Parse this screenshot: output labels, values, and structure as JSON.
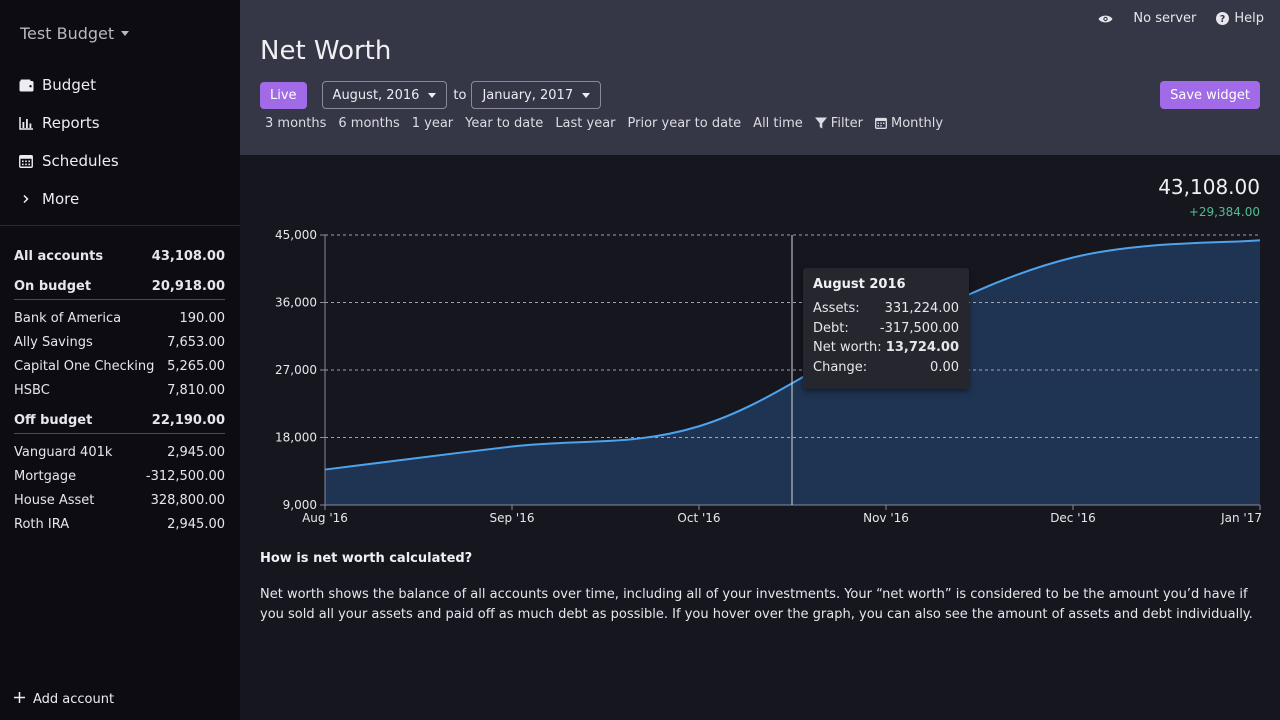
{
  "sidebar": {
    "budget_name": "Test Budget",
    "nav": [
      {
        "label": "Budget",
        "icon": "wallet-icon"
      },
      {
        "label": "Reports",
        "icon": "bar-chart-icon"
      },
      {
        "label": "Schedules",
        "icon": "calendar-icon"
      },
      {
        "label": "More",
        "icon": "chevron-right-icon"
      }
    ],
    "all_accounts": {
      "label": "All accounts",
      "value": "43,108.00"
    },
    "on_budget": {
      "label": "On budget",
      "value": "20,918.00"
    },
    "on_budget_accounts": [
      {
        "name": "Bank of America",
        "value": "190.00"
      },
      {
        "name": "Ally Savings",
        "value": "7,653.00"
      },
      {
        "name": "Capital One Checking",
        "value": "5,265.00"
      },
      {
        "name": "HSBC",
        "value": "7,810.00"
      }
    ],
    "off_budget": {
      "label": "Off budget",
      "value": "22,190.00"
    },
    "off_budget_accounts": [
      {
        "name": "Vanguard 401k",
        "value": "2,945.00"
      },
      {
        "name": "Mortgage",
        "value": "-312,500.00"
      },
      {
        "name": "House Asset",
        "value": "328,800.00"
      },
      {
        "name": "Roth IRA",
        "value": "2,945.00"
      }
    ],
    "add_account": "Add account"
  },
  "topbar": {
    "server": "No server",
    "help": "Help"
  },
  "header": {
    "title": "Net Worth",
    "live": "Live",
    "start": "August, 2016",
    "to": "to",
    "end": "January, 2017",
    "save": "Save widget",
    "ranges": [
      "3 months",
      "6 months",
      "1 year",
      "Year to date",
      "Last year",
      "Prior year to date",
      "All time"
    ],
    "filter": "Filter",
    "interval": "Monthly"
  },
  "summary": {
    "total": "43,108.00",
    "change": "+29,384.00"
  },
  "tooltip": {
    "title": "August 2016",
    "rows": [
      {
        "label": "Assets:",
        "value": "331,224.00"
      },
      {
        "label": "Debt:",
        "value": "-317,500.00"
      },
      {
        "label": "Net worth:",
        "value": "13,724.00"
      },
      {
        "label": "Change:",
        "value": "0.00"
      }
    ]
  },
  "explanation": {
    "title": "How is net worth calculated?",
    "body": "Net worth shows the balance of all accounts over time, including all of your investments. Your “net worth” is considered to be the amount you’d have if you sold all your assets and paid off as much debt as possible. If you hover over the graph, you can also see the amount of assets and debt individually."
  },
  "colors": {
    "accent": "#a16be8",
    "line": "#4ea3ec",
    "area": "#1f3352",
    "positive": "#4fbf8f"
  },
  "chart_data": {
    "type": "area",
    "x": [
      "Aug '16",
      "Sep '16",
      "Oct '16",
      "Nov '16",
      "Dec '16",
      "Jan '17"
    ],
    "series": [
      {
        "values": [
          13724,
          16800,
          19500,
          32000,
          42000,
          44300
        ]
      }
    ],
    "ylim": [
      9000,
      45000
    ],
    "yticks": [
      "9,000",
      "18,000",
      "27,000",
      "36,000",
      "45,000"
    ],
    "grid": true
  }
}
